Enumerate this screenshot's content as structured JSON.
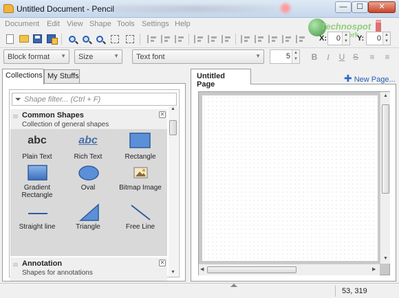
{
  "window": {
    "title": "Untitled Document - Pencil",
    "min_glyph": "—",
    "max_glyph": "☐",
    "close_glyph": "✕"
  },
  "menu": [
    "Document",
    "Edit",
    "View",
    "Shape",
    "Tools",
    "Settings",
    "Help"
  ],
  "watermark": {
    "line1": "Technospot",
    "line2": "Network",
    "tag": "beta"
  },
  "position": {
    "x_label": "X:",
    "x_value": "0",
    "y_label": "Y:",
    "y_value": "0"
  },
  "format_bar": {
    "block_format": "Block format",
    "size": "Size",
    "font": "Text font",
    "font_size": "5",
    "bold": "B",
    "italic": "I",
    "underline": "U",
    "strike": "S"
  },
  "left_tabs": {
    "collections": "Collections",
    "my_stuffs": "My Stuffs"
  },
  "filter": {
    "placeholder": "Shape filter... (Ctrl + F)"
  },
  "collections": [
    {
      "title": "Common Shapes",
      "description": "Collection of general shapes"
    },
    {
      "title": "Annotation",
      "description": "Shapes for annotations"
    }
  ],
  "shapes": [
    {
      "label": "Plain Text",
      "icon": "plain-text-icon",
      "icon_text": "abc"
    },
    {
      "label": "Rich Text",
      "icon": "rich-text-icon",
      "icon_text": "abc"
    },
    {
      "label": "Rectangle",
      "icon": "rectangle-icon"
    },
    {
      "label": "Gradient Rectangle",
      "icon": "gradient-rectangle-icon"
    },
    {
      "label": "Oval",
      "icon": "oval-icon"
    },
    {
      "label": "Bitmap Image",
      "icon": "bitmap-image-icon"
    },
    {
      "label": "Straight line",
      "icon": "straight-line-icon"
    },
    {
      "label": "Triangle",
      "icon": "triangle-icon"
    },
    {
      "label": "Free Line",
      "icon": "free-line-icon"
    }
  ],
  "page_tab": {
    "label": "Untitled Page"
  },
  "new_page": {
    "label": "New Page..."
  },
  "status": {
    "coords": "53, 319"
  },
  "colors": {
    "accent": "#2460b0",
    "shape_fill": "#5b8fd8",
    "shape_stroke": "#2f5c9a",
    "panel_bg": "#d9d9d9"
  }
}
